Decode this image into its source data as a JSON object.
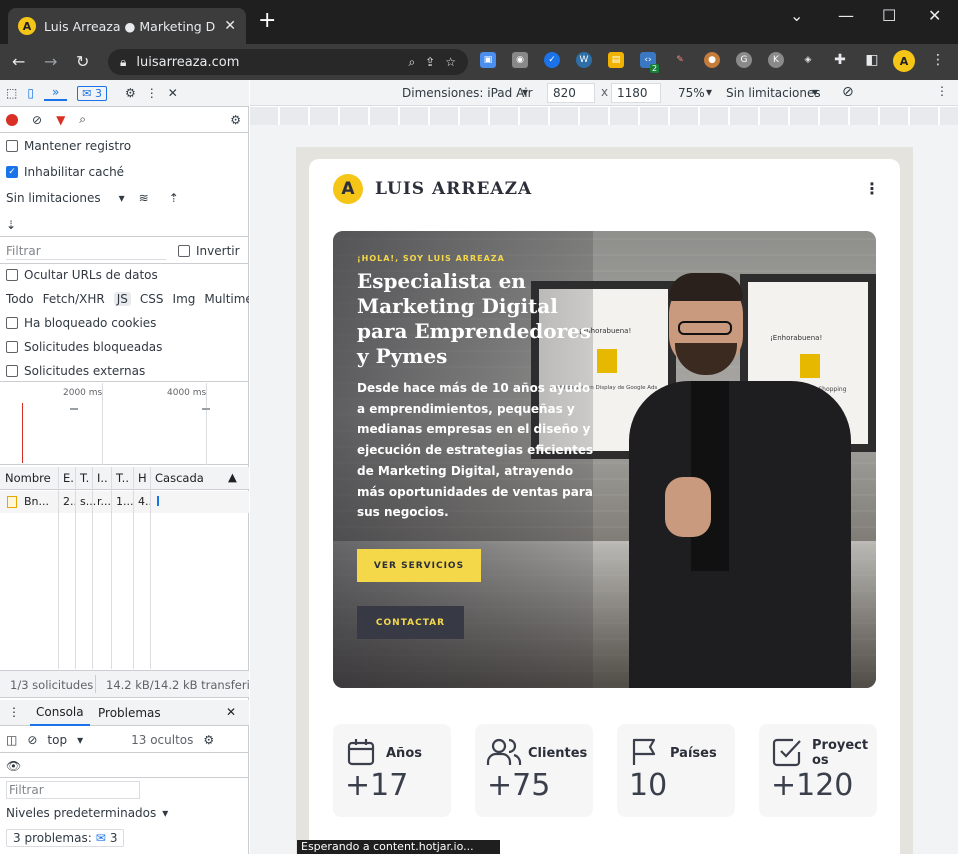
{
  "browser": {
    "tab_title": "Luis Arreaza ● Marketing Digital,",
    "url": "luisarreaza.com",
    "new_tab": "+",
    "tab_close": "✕",
    "favicon_letter": "A",
    "window_controls": [
      "⌄",
      "—",
      "☐",
      "✕"
    ],
    "ext_badge": "2",
    "accent": "#f5c518"
  },
  "devtools": {
    "messages_count": "3",
    "more_tabs": "»",
    "preserve_log": "Mantener registro",
    "disable_cache": "Inhabilitar caché",
    "throttling": "Sin limitaciones",
    "filter_placeholder": "Filtrar",
    "invert": "Invertir",
    "hide_data_urls": "Ocultar URLs de datos",
    "filter_types": [
      "Todo",
      "Fetch/XHR",
      "JS",
      "CSS",
      "Img",
      "Multimedi"
    ],
    "blocked_cookies": "Ha bloqueado cookies",
    "blocked_requests": "Solicitudes bloqueadas",
    "third_party": "Solicitudes externas",
    "timeline_ticks": [
      "2000 ms",
      "4000 ms"
    ],
    "columns": [
      "Nombre",
      "E.",
      "T.",
      "I..",
      "T..",
      "H",
      "Cascada"
    ],
    "request_row": [
      "Bn...",
      "2..",
      "s...",
      "r...",
      "1...",
      "4.."
    ],
    "summary_requests": "1/3 solicitudes",
    "summary_transfer": "14.2 kB/14.2 kB transferido",
    "drawer_tabs": [
      "Consola",
      "Problemas"
    ],
    "context": "top",
    "hidden": "13 ocultos",
    "console_filter": "Filtrar",
    "levels": "Niveles predeterminados",
    "problems": "3 problemas:",
    "problems_count": "3"
  },
  "device_toolbar": {
    "dimensions": "Dimensiones: iPad Air",
    "width": "820",
    "times": "x",
    "height": "1180",
    "zoom": "75%",
    "throttle": "Sin limitaciones"
  },
  "site": {
    "logo_letter": "A",
    "brand": "LUIS ARREAZA",
    "menu_icon": "⋮",
    "eyebrow": "¡HOLA!, SOY LUIS ARREAZA",
    "headline": "Especialista en Marketing Digital para Emprendedores y Pymes",
    "body": "Desde hace más de 10 años ayudo a emprendimientos, pequeñas y medianas empresas en el diseño y ejecución de estrategias eficientes de Marketing Digital, atrayendo más oportunidades de ventas para sus negocios.",
    "btn_services": "VER SERVICIOS",
    "btn_contact": "CONTACTAR",
    "cert_congrats": "¡Enhorabuena!",
    "cert_left": "Certificación en Display de Google Ads",
    "cert_right": "Certificación en Shopping",
    "stats": [
      {
        "label": "Años",
        "value": "+17"
      },
      {
        "label": "Clientes",
        "value": "+75"
      },
      {
        "label": "Países",
        "value": "10"
      },
      {
        "label": "Proyect\nos",
        "value": "+120"
      }
    ],
    "status_bar": "Esperando a content.hotjar.io..."
  }
}
